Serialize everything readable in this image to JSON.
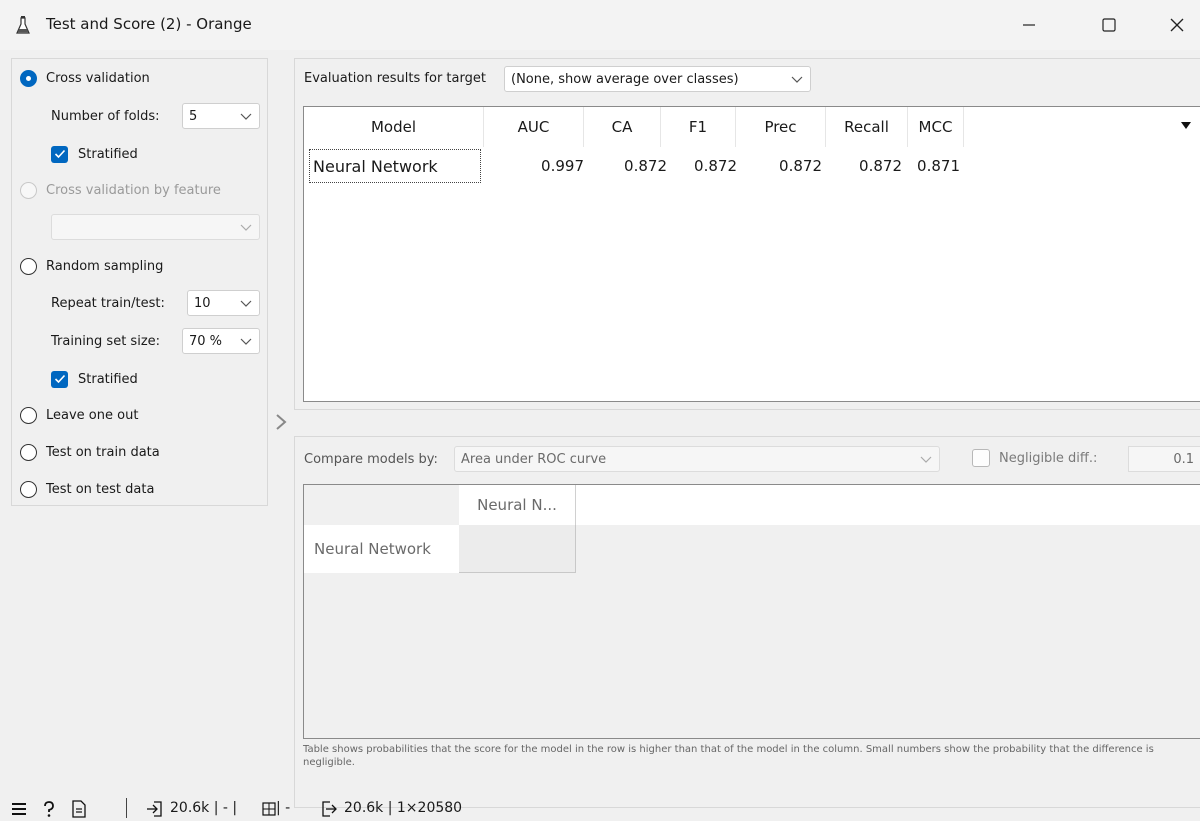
{
  "window": {
    "title": "Test and Score (2) - Orange",
    "minimize_icon": "minimize-icon",
    "maximize_icon": "maximize-icon",
    "close_icon": "close-icon"
  },
  "sampling": {
    "cross_validation": {
      "label": "Cross validation",
      "checked": true
    },
    "folds": {
      "label": "Number of folds:",
      "value": "5"
    },
    "cv_stratified": {
      "label": "Stratified",
      "checked": true
    },
    "cv_by_feature": {
      "label": "Cross validation by feature",
      "enabled": false,
      "value": ""
    },
    "random_sampling": {
      "label": "Random sampling",
      "checked": false
    },
    "repeat": {
      "label": "Repeat train/test:",
      "value": "10"
    },
    "train_size": {
      "label": "Training set size:",
      "value": "70 %"
    },
    "rs_stratified": {
      "label": "Stratified",
      "checked": true
    },
    "leave_one_out": {
      "label": "Leave one out"
    },
    "test_on_train": {
      "label": "Test on train data"
    },
    "test_on_test": {
      "label": "Test on test data"
    }
  },
  "evaluation": {
    "target_label": "Evaluation results for target",
    "target_value": "(None, show average over classes)",
    "columns": [
      "Model",
      "AUC",
      "CA",
      "F1",
      "Prec",
      "Recall",
      "MCC"
    ],
    "rows": [
      {
        "model": "Neural Network",
        "auc": "0.997",
        "ca": "0.872",
        "f1": "0.872",
        "prec": "0.872",
        "recall": "0.872",
        "mcc": "0.871"
      }
    ]
  },
  "compare": {
    "label": "Compare models by:",
    "value": "Area under ROC curve",
    "negligible_label": "Negligible diff.:",
    "negligible_value": "0.1",
    "negligible_checked": false,
    "col_header": "Neural N...",
    "row_header": "Neural Network",
    "footnote": "Table shows probabilities that the score for the model in the row is higher than that of the model in the column. Small numbers show the probability that the difference is negligible."
  },
  "status": {
    "input_summary": "20.6k | - | ",
    "input_summary_tail": " | -",
    "output_summary": "20.6k | 1×20580"
  },
  "colors": {
    "accent": "#0067c0",
    "window_bg": "#f0f0f0"
  }
}
